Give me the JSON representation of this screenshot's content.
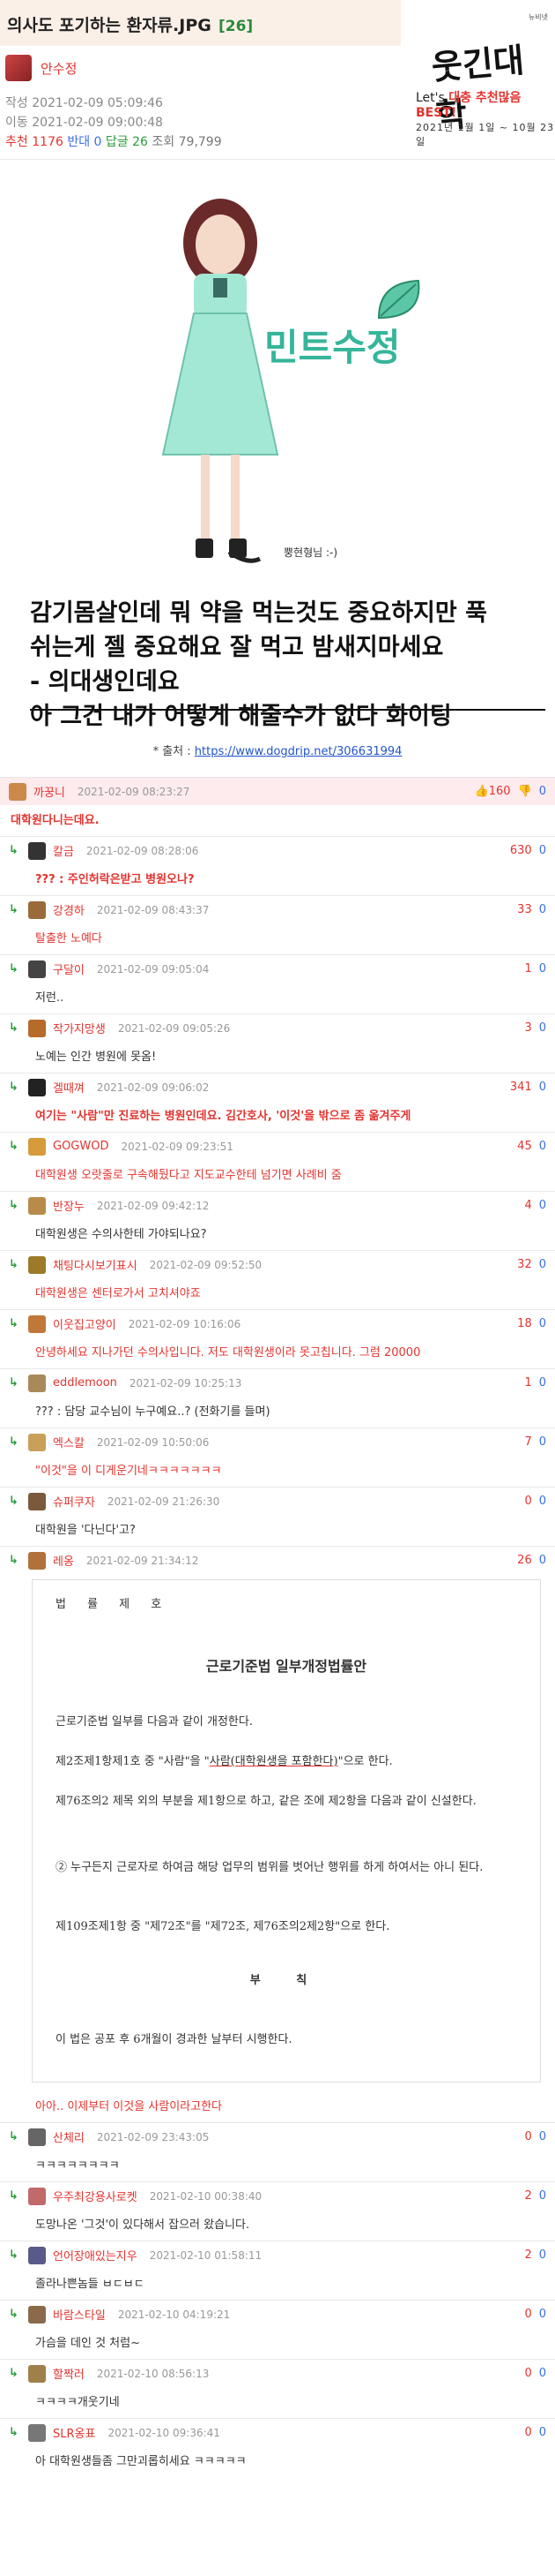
{
  "post": {
    "title": "의사도 포기하는 환자류.JPG",
    "comment_count": "[26]",
    "author": "안수정",
    "created": "작성 2021-02-09 05:09:46",
    "moved": "이동 2021-02-09 09:00:48",
    "recommend_label": "추천",
    "recommend": "1176",
    "oppose_label": "반대",
    "oppose": "0",
    "reply_label": "답글",
    "reply": "26",
    "views_label": "조회",
    "views": "79,799"
  },
  "logo": {
    "small": "뉴비넷",
    "main": "웃긴대학",
    "tag_prefix": "Let's",
    "tag_main": "대충 추천많음 BEST!",
    "sub": "2021년 1월 1일 ~ 10월 23일"
  },
  "comic": {
    "mint_text": "민트수정",
    "signature": "뿡현형님 :-)",
    "line1": "감기몸살인데 뭐 약을 먹는것도 중요하지만 푹",
    "line2": "쉬는게 젤 중요해요 잘 먹고 밤새지마세요",
    "line3": "- 의대생인데요",
    "line4": "아 그건 내가 어떻게 해줄수가 없다 화이팅"
  },
  "source": {
    "label": "* 출처 :",
    "url": "https://www.dogdrip.net/306631994"
  },
  "colors": {
    "accent_red": "#e3342f",
    "accent_blue": "#3b6ee3",
    "accent_green": "#2a9a3a",
    "header_bg": "#fbf0e8",
    "first_comment_bg": "#fdebee"
  },
  "comments": [
    {
      "nick": "까꿍니",
      "time": "2021-02-09 08:23:27",
      "up": "160",
      "down": "0",
      "text": "대학원다니는데요.",
      "reply": false
    },
    {
      "nick": "칼금",
      "time": "2021-02-09 08:28:06",
      "up": "630",
      "down": "0",
      "text": "??? : 주인허락은받고 병원오나?",
      "reply": true
    },
    {
      "nick": "강경하",
      "time": "2021-02-09 08:43:37",
      "up": "33",
      "down": "0",
      "text": "탈출한 노예다",
      "reply": true
    },
    {
      "nick": "구달이",
      "time": "2021-02-09 09:05:04",
      "up": "1",
      "down": "0",
      "text": "저런..",
      "reply": true
    },
    {
      "nick": "작가지망생",
      "time": "2021-02-09 09:05:26",
      "up": "3",
      "down": "0",
      "text": "노예는 인간 병원에 못옴!",
      "reply": true
    },
    {
      "nick": "겔때껴",
      "time": "2021-02-09 09:06:02",
      "up": "341",
      "down": "0",
      "text": "여기는 \"사람\"만 진료하는 병원인데요. 김간호사, '이것'을 밖으로 좀 옮겨주게",
      "reply": true
    },
    {
      "nick": "GOGWOD",
      "time": "2021-02-09 09:23:51",
      "up": "45",
      "down": "0",
      "text": "대학원생 오랏줄로 구속해뒀다고 지도교수한테 넘기면 사례비 줌",
      "reply": true
    },
    {
      "nick": "반장누",
      "time": "2021-02-09 09:42:12",
      "up": "4",
      "down": "0",
      "text": "대학원생은 수의사한테 가야되나요?",
      "reply": true
    },
    {
      "nick": "채팅다시보기표시",
      "time": "2021-02-09 09:52:50",
      "up": "32",
      "down": "0",
      "text": "대학원생은 센터로가서 고치셔야죠",
      "reply": true
    },
    {
      "nick": "이웃집고양이",
      "time": "2021-02-09 10:16:06",
      "up": "18",
      "down": "0",
      "text": "안녕하세요 지나가던 수의사입니다. 저도 대학원생이라 못고칩니다. 그럼 20000",
      "reply": true
    },
    {
      "nick": "eddlemoon",
      "time": "2021-02-09 10:25:13",
      "up": "1",
      "down": "0",
      "text": "??? : 담당 교수님이 누구예요..? (전화기를 들며)",
      "reply": true
    },
    {
      "nick": "엑스칼",
      "time": "2021-02-09 10:50:06",
      "up": "7",
      "down": "0",
      "text": "\"이것\"을 이 디게운기네ㅋㅋㅋㅋㅋㅋㅋ",
      "reply": true
    },
    {
      "nick": "슈퍼쿠자",
      "time": "2021-02-09 21:26:30",
      "up": "0",
      "down": "0",
      "text": "대학원을 '다닌다'고?",
      "reply": true
    },
    {
      "nick": "레옹",
      "time": "2021-02-09 21:34:12",
      "up": "26",
      "down": "0",
      "text": "아아.. 이제부터 이것을 사람이라고한다",
      "reply": true
    },
    {
      "nick": "산체리",
      "time": "2021-02-09 23:43:05",
      "up": "0",
      "down": "0",
      "text": "ㅋㅋㅋㅋㅋㅋㅋㅋ",
      "reply": true
    },
    {
      "nick": "우주최강용사로켓",
      "time": "2021-02-10 00:38:40",
      "up": "2",
      "down": "0",
      "text": "도망나온 '그것'이 있다해서 잡으러 왔습니다.",
      "reply": true
    },
    {
      "nick": "언어장애있는지우",
      "time": "2021-02-10 01:58:11",
      "up": "2",
      "down": "0",
      "text": "졸라나쁜놈들 ㅂㄷㅂㄷ",
      "reply": true
    },
    {
      "nick": "바람스타일",
      "time": "2021-02-10 04:19:21",
      "up": "0",
      "down": "0",
      "text": "가슴을 데인 것 처럼~",
      "reply": true
    },
    {
      "nick": "할짝러",
      "time": "2021-02-10 08:56:13",
      "up": "0",
      "down": "0",
      "text": "ㅋㅋㅋㅋ개웃기네",
      "reply": true
    },
    {
      "nick": "SLR옹표",
      "time": "2021-02-10 09:36:41",
      "up": "0",
      "down": "0",
      "text": "아 대학원생들좀 그만괴롭히세요 ㅋㅋㅋㅋㅋ",
      "reply": true
    }
  ],
  "law": {
    "no": "법 률 제 호",
    "heading": "근로기준법 일부개정법률안",
    "p1": "근로기준법 일부를 다음과 같이 개정한다.",
    "p2a": "제2조제1항제1호 중 \"사람\"을 \"",
    "p2u": "사람(대학원생을 포함한다)",
    "p2b": "\"으로 한다.",
    "p3": "제76조의2 제목 외의 부분을 제1항으로 하고, 같은 조에 제2항을 다음과 같이 신설한다.",
    "p4": "② 누구든지 근로자로 하여금 해당 업무의 범위를 벗어난 행위를 하게 하여서는 아니 된다.",
    "p5": "제109조제1항 중 \"제72조\"를 \"제72조, 제76조의2제2항\"으로 한다.",
    "buchik": "부 칙",
    "p6": "이 법은 공포 후 6개월이 경과한 날부터 시행한다."
  }
}
